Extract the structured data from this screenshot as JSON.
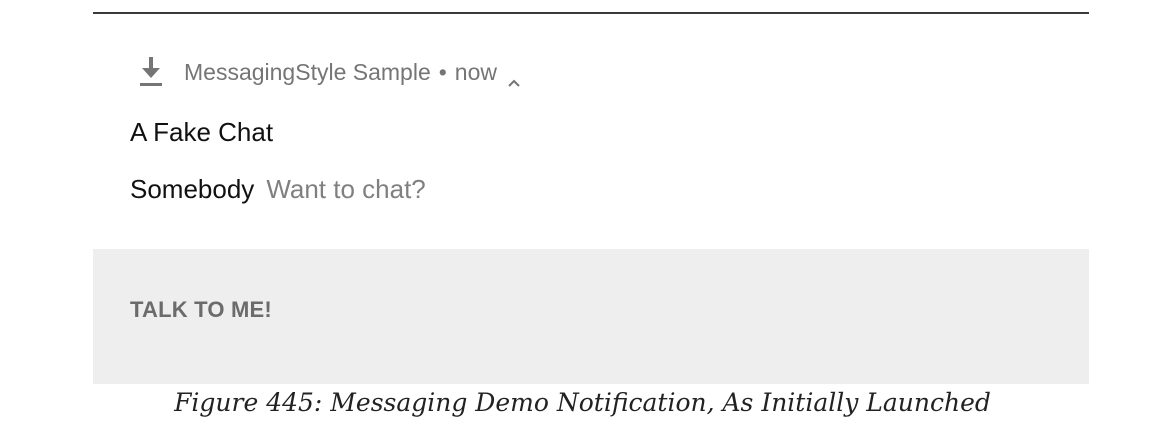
{
  "notification": {
    "app_name": "MessagingStyle Sample",
    "separator": "•",
    "time": "now",
    "icon": "download-icon",
    "expand_icon": "chevron-up-icon",
    "title": "A Fake Chat",
    "message": {
      "sender": "Somebody",
      "text": "Want to chat?"
    },
    "action": {
      "label": "TALK TO ME!"
    }
  },
  "caption": "Figure 445: Messaging Demo Notification, As Initially Launched",
  "colors": {
    "header_text": "#757575",
    "title_text": "#111111",
    "message_text": "#808080",
    "action_bar_bg": "#eeeeee",
    "action_text": "#6b6b6b"
  }
}
